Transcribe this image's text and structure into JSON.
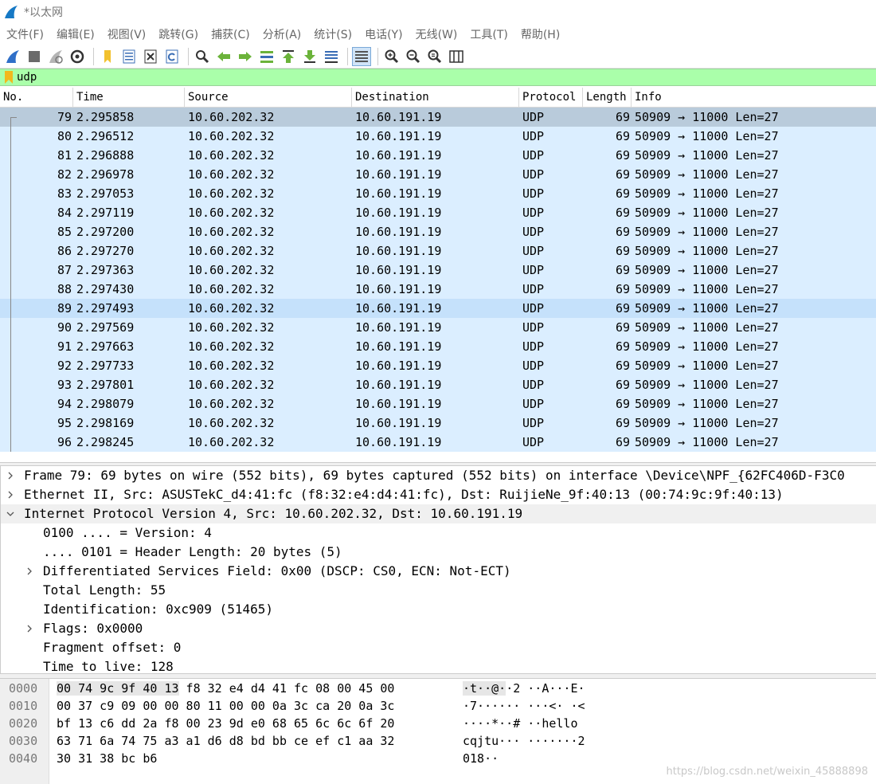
{
  "window": {
    "title": "*以太网"
  },
  "menu": [
    "文件(F)",
    "编辑(E)",
    "视图(V)",
    "跳转(G)",
    "捕获(C)",
    "分析(A)",
    "统计(S)",
    "电话(Y)",
    "无线(W)",
    "工具(T)",
    "帮助(H)"
  ],
  "toolbar": {
    "buttons": [
      "start-capture-icon",
      "stop-capture-icon",
      "restart-capture-icon",
      "capture-options-icon",
      "open-file-icon",
      "save-file-icon",
      "close-file-icon",
      "reload-file-icon",
      "find-packet-icon",
      "go-back-icon",
      "go-forward-icon",
      "go-to-packet-icon",
      "go-first-icon",
      "go-last-icon",
      "autoscroll-icon",
      "colorize-icon",
      "zoom-in-icon",
      "zoom-out-icon",
      "zoom-normal-icon",
      "resize-columns-icon"
    ]
  },
  "filter": {
    "value": "udp"
  },
  "packet_list": {
    "columns": [
      "No.",
      "Time",
      "Source",
      "Destination",
      "Protocol",
      "Length",
      "Info"
    ],
    "rows": [
      {
        "no": "79",
        "time": "2.295858",
        "src": "10.60.202.32",
        "dst": "10.60.191.19",
        "proto": "UDP",
        "len": "69",
        "info": "50909 → 11000 Len=27"
      },
      {
        "no": "80",
        "time": "2.296512",
        "src": "10.60.202.32",
        "dst": "10.60.191.19",
        "proto": "UDP",
        "len": "69",
        "info": "50909 → 11000 Len=27"
      },
      {
        "no": "81",
        "time": "2.296888",
        "src": "10.60.202.32",
        "dst": "10.60.191.19",
        "proto": "UDP",
        "len": "69",
        "info": "50909 → 11000 Len=27"
      },
      {
        "no": "82",
        "time": "2.296978",
        "src": "10.60.202.32",
        "dst": "10.60.191.19",
        "proto": "UDP",
        "len": "69",
        "info": "50909 → 11000 Len=27"
      },
      {
        "no": "83",
        "time": "2.297053",
        "src": "10.60.202.32",
        "dst": "10.60.191.19",
        "proto": "UDP",
        "len": "69",
        "info": "50909 → 11000 Len=27"
      },
      {
        "no": "84",
        "time": "2.297119",
        "src": "10.60.202.32",
        "dst": "10.60.191.19",
        "proto": "UDP",
        "len": "69",
        "info": "50909 → 11000 Len=27"
      },
      {
        "no": "85",
        "time": "2.297200",
        "src": "10.60.202.32",
        "dst": "10.60.191.19",
        "proto": "UDP",
        "len": "69",
        "info": "50909 → 11000 Len=27"
      },
      {
        "no": "86",
        "time": "2.297270",
        "src": "10.60.202.32",
        "dst": "10.60.191.19",
        "proto": "UDP",
        "len": "69",
        "info": "50909 → 11000 Len=27"
      },
      {
        "no": "87",
        "time": "2.297363",
        "src": "10.60.202.32",
        "dst": "10.60.191.19",
        "proto": "UDP",
        "len": "69",
        "info": "50909 → 11000 Len=27"
      },
      {
        "no": "88",
        "time": "2.297430",
        "src": "10.60.202.32",
        "dst": "10.60.191.19",
        "proto": "UDP",
        "len": "69",
        "info": "50909 → 11000 Len=27"
      },
      {
        "no": "89",
        "time": "2.297493",
        "src": "10.60.202.32",
        "dst": "10.60.191.19",
        "proto": "UDP",
        "len": "69",
        "info": "50909 → 11000 Len=27"
      },
      {
        "no": "90",
        "time": "2.297569",
        "src": "10.60.202.32",
        "dst": "10.60.191.19",
        "proto": "UDP",
        "len": "69",
        "info": "50909 → 11000 Len=27"
      },
      {
        "no": "91",
        "time": "2.297663",
        "src": "10.60.202.32",
        "dst": "10.60.191.19",
        "proto": "UDP",
        "len": "69",
        "info": "50909 → 11000 Len=27"
      },
      {
        "no": "92",
        "time": "2.297733",
        "src": "10.60.202.32",
        "dst": "10.60.191.19",
        "proto": "UDP",
        "len": "69",
        "info": "50909 → 11000 Len=27"
      },
      {
        "no": "93",
        "time": "2.297801",
        "src": "10.60.202.32",
        "dst": "10.60.191.19",
        "proto": "UDP",
        "len": "69",
        "info": "50909 → 11000 Len=27"
      },
      {
        "no": "94",
        "time": "2.298079",
        "src": "10.60.202.32",
        "dst": "10.60.191.19",
        "proto": "UDP",
        "len": "69",
        "info": "50909 → 11000 Len=27"
      },
      {
        "no": "95",
        "time": "2.298169",
        "src": "10.60.202.32",
        "dst": "10.60.191.19",
        "proto": "UDP",
        "len": "69",
        "info": "50909 → 11000 Len=27"
      },
      {
        "no": "96",
        "time": "2.298245",
        "src": "10.60.202.32",
        "dst": "10.60.191.19",
        "proto": "UDP",
        "len": "69",
        "info": "50909 → 11000 Len=27"
      }
    ],
    "selected_no": "79",
    "hover_no": "89"
  },
  "details": [
    {
      "text": "Frame 79: 69 bytes on wire (552 bits), 69 bytes captured (552 bits) on interface \\Device\\NPF_{62FC406D-F3C0",
      "level": 0,
      "arrow": "collapsed"
    },
    {
      "text": "Ethernet II, Src: ASUSTekC_d4:41:fc (f8:32:e4:d4:41:fc), Dst: RuijieNe_9f:40:13 (00:74:9c:9f:40:13)",
      "level": 0,
      "arrow": "collapsed"
    },
    {
      "text": "Internet Protocol Version 4, Src: 10.60.202.32, Dst: 10.60.191.19",
      "level": 0,
      "arrow": "expanded"
    },
    {
      "text": "0100 .... = Version: 4",
      "level": 1,
      "arrow": "none"
    },
    {
      "text": ".... 0101 = Header Length: 20 bytes (5)",
      "level": 1,
      "arrow": "none"
    },
    {
      "text": "Differentiated Services Field: 0x00 (DSCP: CS0, ECN: Not-ECT)",
      "level": 1,
      "arrow": "collapsed"
    },
    {
      "text": "Total Length: 55",
      "level": 1,
      "arrow": "none"
    },
    {
      "text": "Identification: 0xc909 (51465)",
      "level": 1,
      "arrow": "none"
    },
    {
      "text": "Flags: 0x0000",
      "level": 1,
      "arrow": "collapsed"
    },
    {
      "text": "Fragment offset: 0",
      "level": 1,
      "arrow": "none"
    },
    {
      "text": "Time to live: 128",
      "level": 1,
      "arrow": "none"
    }
  ],
  "bytes": [
    {
      "offset": "0000",
      "hex1": "00 74 9c 9f 40 13",
      "hex2": " f8 32",
      "hex3": "e4 d4 41 fc 08 00 45 00",
      "ascii1": "·t··@·",
      "ascii2": "·2",
      "ascii3": "··A···E·"
    },
    {
      "offset": "0010",
      "hex1": "00 37 c9 09 00 00 80 11",
      "hex2": "",
      "hex3": "00 00 0a 3c ca 20 0a 3c",
      "ascii1": "·7······",
      "ascii2": "",
      "ascii3": "···<· ·<"
    },
    {
      "offset": "0020",
      "hex1": "bf 13 c6 dd 2a f8 00 23",
      "hex2": "",
      "hex3": "9d e0 68 65 6c 6c 6f 20",
      "ascii1": "····*··#",
      "ascii2": "",
      "ascii3": "··hello "
    },
    {
      "offset": "0030",
      "hex1": "63 71 6a 74 75 a3 a1 d6",
      "hex2": "",
      "hex3": "d8 bd bb ce ef c1 aa 32",
      "ascii1": "cqjtu···",
      "ascii2": "",
      "ascii3": "·······2"
    },
    {
      "offset": "0040",
      "hex1": "30 31 38 bc b6",
      "hex2": "",
      "hex3": "",
      "ascii1": "018··",
      "ascii2": "",
      "ascii3": ""
    }
  ],
  "watermark": "https://blog.csdn.net/weixin_45888898",
  "colors": {
    "filter_valid_bg": "#aaffaa",
    "row_bg": "#dbeeff",
    "selected_row_bg": "#b9cbdb",
    "hover_row_bg": "#c5e1fb"
  }
}
